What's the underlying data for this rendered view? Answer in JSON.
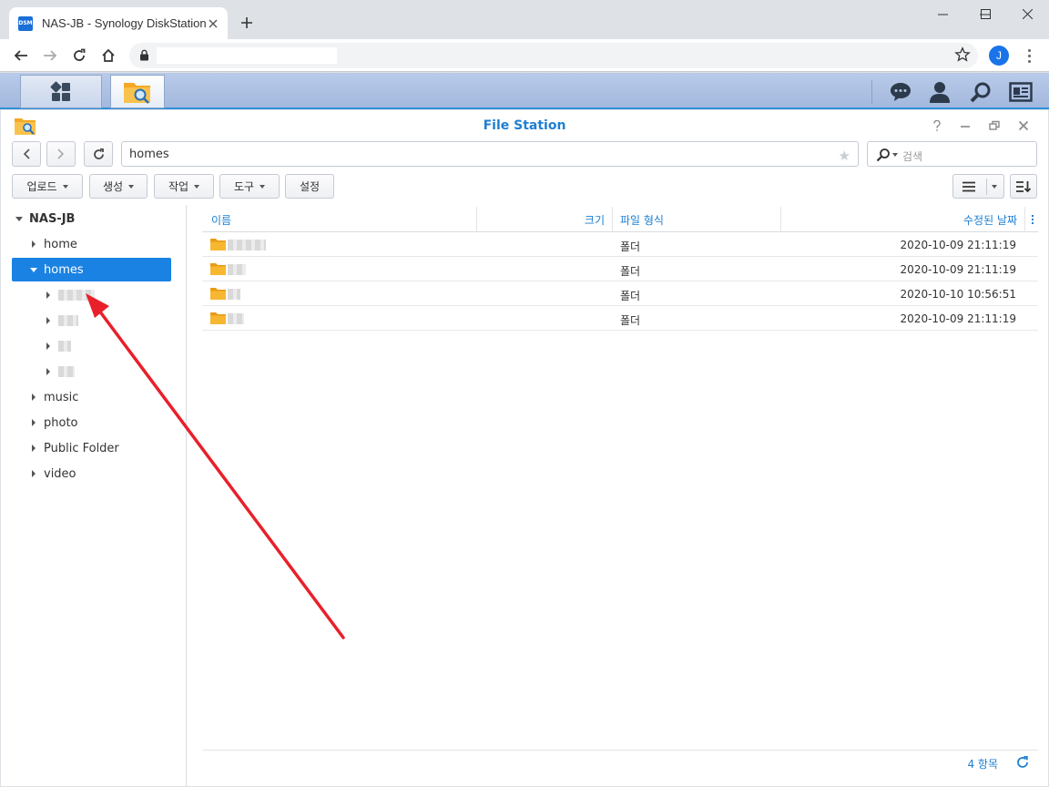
{
  "browser": {
    "tab_title": "NAS-JB - Synology DiskStation",
    "favicon_text": "DSM",
    "profile_initial": "J",
    "url": ""
  },
  "file_station": {
    "title": "File Station",
    "path": "homes",
    "search_placeholder": "검색",
    "toolbar": {
      "upload": "업로드",
      "create": "생성",
      "action": "작업",
      "tools": "도구",
      "settings": "설정"
    },
    "tree": {
      "root": "NAS-JB",
      "items": [
        "home",
        "homes",
        "music",
        "photo",
        "Public Folder",
        "video"
      ]
    },
    "columns": {
      "name": "이름",
      "size": "크기",
      "type": "파일 형식",
      "modified": "수정된 날짜"
    },
    "rows": [
      {
        "type": "폴더",
        "modified": "2020-10-09 21:11:19"
      },
      {
        "type": "폴더",
        "modified": "2020-10-09 21:11:19"
      },
      {
        "type": "폴더",
        "modified": "2020-10-10 10:56:51"
      },
      {
        "type": "폴더",
        "modified": "2020-10-09 21:11:19"
      }
    ],
    "footer_count": "4 항목"
  },
  "colors": {
    "accent": "#1a82e2",
    "arrow": "#e8202a",
    "folder": "#f5a623"
  }
}
